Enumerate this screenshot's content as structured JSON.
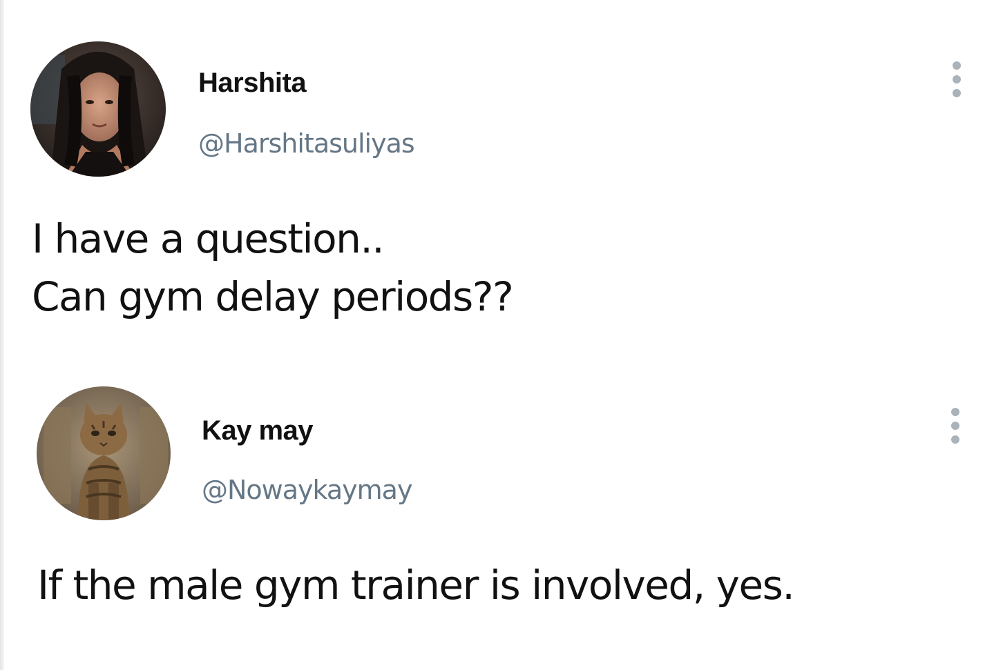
{
  "tweets": [
    {
      "display_name": "Harshita",
      "handle": "@Harshitasuliyas",
      "text_lines": [
        "I have a question..",
        "Can gym delay periods??"
      ],
      "avatar_icon": "woman-portrait-avatar",
      "more_icon": "vertical-ellipsis-icon"
    },
    {
      "display_name": "Kay may",
      "handle": "@Nowaykaymay",
      "text_lines": [
        "If the male gym trainer is involved, yes."
      ],
      "avatar_icon": "cat-portrait-avatar",
      "more_icon": "vertical-ellipsis-icon"
    }
  ],
  "colors": {
    "name": "#111111",
    "handle": "#657786",
    "text": "#111111",
    "more_dots": "#aab3ba",
    "background": "#ffffff"
  }
}
